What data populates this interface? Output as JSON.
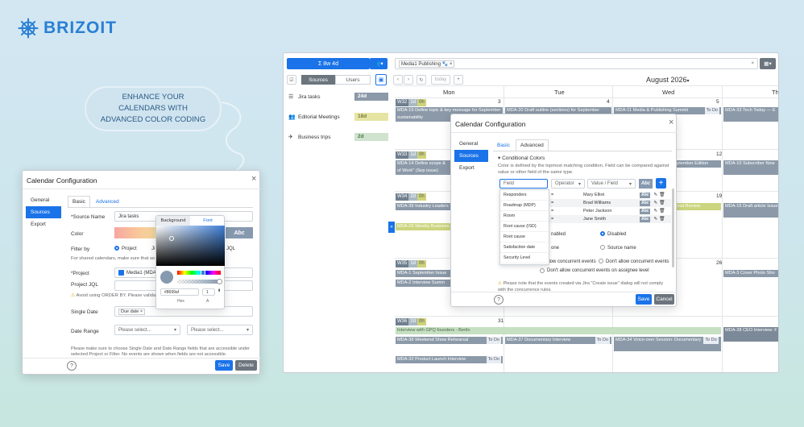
{
  "brand": {
    "name": "BRIZOIT",
    "color": "#2a7fd4"
  },
  "callout": {
    "text": "ENHANCE YOUR CALENDARS WITH ADVANCED COLOR CODING"
  },
  "left_dialog": {
    "title": "Calendar Configuration",
    "sidebar": [
      "General",
      "Sources",
      "Export"
    ],
    "tabs": [
      "Basic",
      "Advanced"
    ],
    "source_name_label": "*Source Name",
    "source_name_value": "Jira tasks",
    "color_label": "Color",
    "abc": "Abc",
    "picker_tabs": [
      "Background",
      "Font"
    ],
    "hex_value": "#8699af",
    "alpha_value": "1",
    "hex_label": "Hex",
    "alpha_label": "A",
    "filter_by_label": "Filter by",
    "filter_opt_project": "Project",
    "filter_opt_ji": "Ji",
    "filter_opt_jql": "JQL",
    "shared_note": "For shared calendars, make sure that so",
    "project_label": "*Project",
    "project_value": "Media1 (MDA",
    "project_jql_label": "Project JQL",
    "avoid_note": "Avoid using ORDER BY. Please valida",
    "single_date_label": "Single Date",
    "single_date_value": "Due date",
    "date_range_label": "Date Range",
    "select_placeholder": "Please select...",
    "bottom_note": "Please make sure to choose Single Date and Date Range fields that are accessible under selected Project or Filter. No events are shown when fields are not accessible.",
    "save": "Save",
    "delete": "Delete"
  },
  "app": {
    "range_button": "Σ 8w 4d",
    "source_tabs": [
      "Sources",
      "Users"
    ],
    "filter_chip": "Media1 Publishing",
    "today": "today",
    "month_title": "August 2026",
    "sources": [
      {
        "icon": "checklist-icon",
        "name": "Jira tasks",
        "badge": "24d",
        "color": "#8b99a8"
      },
      {
        "icon": "users-icon",
        "name": "Editorial Meetings",
        "badge": "18d",
        "color": "#e6e4a3"
      },
      {
        "icon": "plane-icon",
        "name": "Business trips",
        "badge": "2d",
        "color": "#cfe3cf"
      }
    ],
    "days": [
      "Mon",
      "Tue",
      "Wed",
      "Th"
    ],
    "weeks": [
      {
        "wk": "W32",
        "d": "1d",
        "h": "0h",
        "nums": [
          "3",
          "4",
          "5"
        ],
        "events": [
          {
            "text": "MDA-19 Define topic & key message for September sustainability",
            "col": 0
          },
          {
            "text": "MDA-20 Draft outline (sections) for September",
            "col": 1
          },
          {
            "text": "MDA-11 Media & Publishing Summit",
            "col": 2,
            "todo": "To Do"
          },
          {
            "text": "MDA-33 Tech Today — E",
            "col": 3
          }
        ]
      },
      {
        "wk": "W33",
        "d": "1d",
        "h": "0h",
        "nums": [
          "12"
        ],
        "events": [
          {
            "text": "MDA-14 Define scope & of Work\" (Sep issue)",
            "col": 0
          },
          {
            "text": "eptember Edition",
            "col": 2
          },
          {
            "text": "MDA-10 Subscriber New",
            "col": 3
          }
        ]
      },
      {
        "wk": "W34",
        "d": "2d",
        "h": "0h",
        "nums": [
          "19"
        ],
        "events": [
          {
            "text": "MDA-39 Industry Leaders",
            "col": 0
          },
          {
            "text": "MDA-29 Weekly Business",
            "col": 0
          },
          {
            "text": "torial Review",
            "col": 2
          },
          {
            "text": "MDA-15 Draft article Issue",
            "col": 3
          }
        ]
      },
      {
        "wk": "W35",
        "d": "1d",
        "h": "0h",
        "nums": [
          "26"
        ],
        "events": [
          {
            "text": "MDA-1 September Issue",
            "col": 0
          },
          {
            "text": "MDA-2 Interview Summ",
            "col": 0
          },
          {
            "text": "MDA-3 Cover Photo Sho",
            "col": 3
          }
        ]
      },
      {
        "wk": "W36",
        "d": "2d",
        "h": "0h",
        "nums": [
          "31"
        ],
        "events": [
          {
            "text": "Interview with GPQ founders - Berlin",
            "col": 0
          },
          {
            "text": "MDA-38 Weekend Show Rehearsal",
            "col": 0,
            "todo": "To Do"
          },
          {
            "text": "MDA-37 Documentary Interview",
            "col": 1,
            "todo": "To Do"
          },
          {
            "text": "MDA-34 Voice-over Session: Documentary",
            "col": 2,
            "todo": "To Do"
          },
          {
            "text": "MDA-28 CEO Interview: F",
            "col": 3
          },
          {
            "text": "MDA-32 Product Launch Interview",
            "col": 0,
            "todo": "To Do"
          }
        ]
      }
    ]
  },
  "right_dialog": {
    "title": "Calendar Configuration",
    "sidebar": [
      "General",
      "Sources",
      "Export"
    ],
    "tabs": [
      "Basic",
      "Advanced"
    ],
    "section": "Conditional Colors",
    "desc": "Color is defined by the topmost matching condition. Field can be compared against value or other field of the same type.",
    "field_placeholder": "Field",
    "operator_placeholder": "Operator",
    "value_placeholder": "Value / Field",
    "abc": "Abc",
    "add": "+",
    "field_menu": [
      "Responders",
      "Roadmap (MDP)",
      "Room",
      "Root cause (ISD)",
      "Root cause",
      "Satisfaction date",
      "Security Level"
    ],
    "conditions": [
      {
        "op": "=",
        "value": "Mary Elliot"
      },
      {
        "op": "=",
        "value": "Brad Williams"
      },
      {
        "op": "=",
        "value": "Peter Jackson"
      },
      {
        "op": "=",
        "value": "Jane Smith"
      }
    ],
    "enabled_label": "nabled",
    "disabled_label": "Disabled",
    "none_label": "one",
    "source_name_label": "Source name",
    "allow_label": "llow concurrent events",
    "dont_allow_label": "Don't allow concurrent events",
    "dont_allow_assignee": "Don't allow concurrent events on assignee level",
    "warn": "Please note that the events created via Jira \"Create issue\" dialog will not comply with the concurrence rules.",
    "save": "Save",
    "cancel": "Cancel"
  }
}
